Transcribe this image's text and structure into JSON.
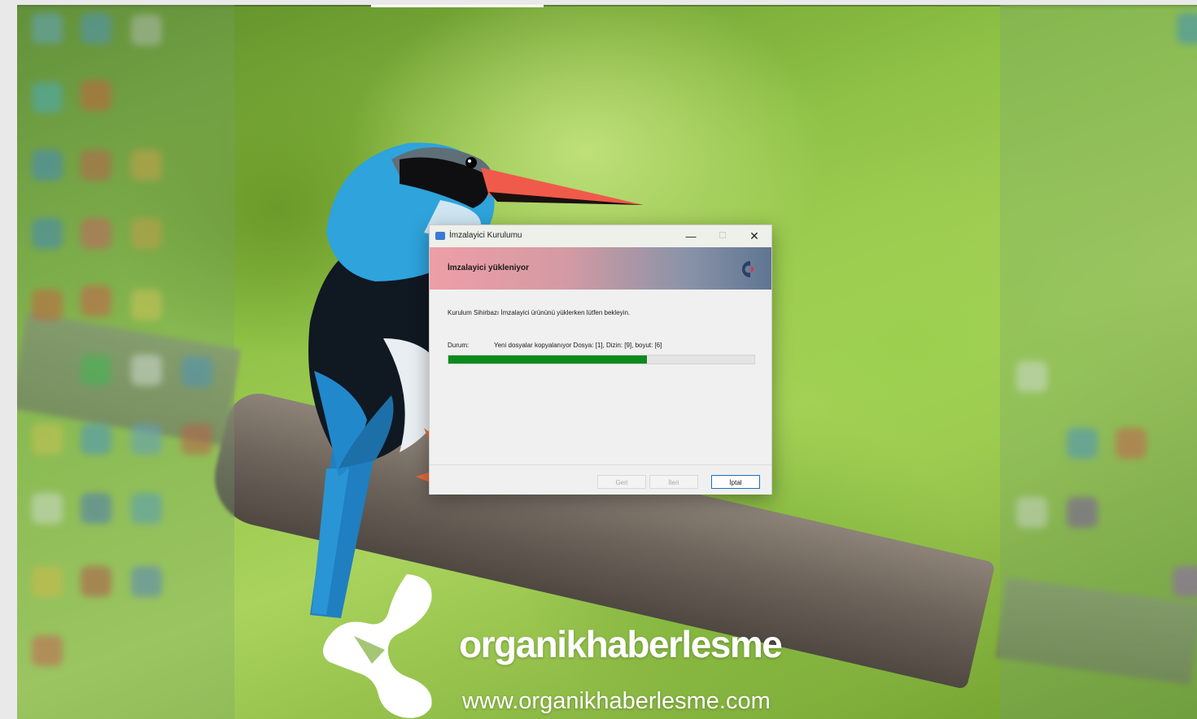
{
  "window": {
    "title": "İmzalayici Kurulumu",
    "minimize_glyph": "—",
    "maximize_glyph": "☐",
    "close_glyph": "✕"
  },
  "banner": {
    "title": "İmzalayici yükleniyor",
    "logo_icon": "installer-brand-logo"
  },
  "content": {
    "description": "Kurulum Sihirbazı İmzalayici ürününü yüklerken lütfen bekleyin.",
    "status_label": "Durum:",
    "status_text": "Yeni dosyalar kopyalanıyor Dosya: [1], Dizin: [9], boyut: [6]",
    "progress_fraction": 0.65
  },
  "buttons": {
    "back": "Geri",
    "next": "İleri",
    "cancel": "İptal"
  },
  "watermark": {
    "name": "organikhaberlesme",
    "url": "www.organikhaberlesme.com"
  },
  "colors": {
    "progress": "#0b8a1d",
    "banner_start": "#ee9ea7",
    "banner_end": "#5f7592",
    "cancel_border": "#1f6fbf"
  }
}
